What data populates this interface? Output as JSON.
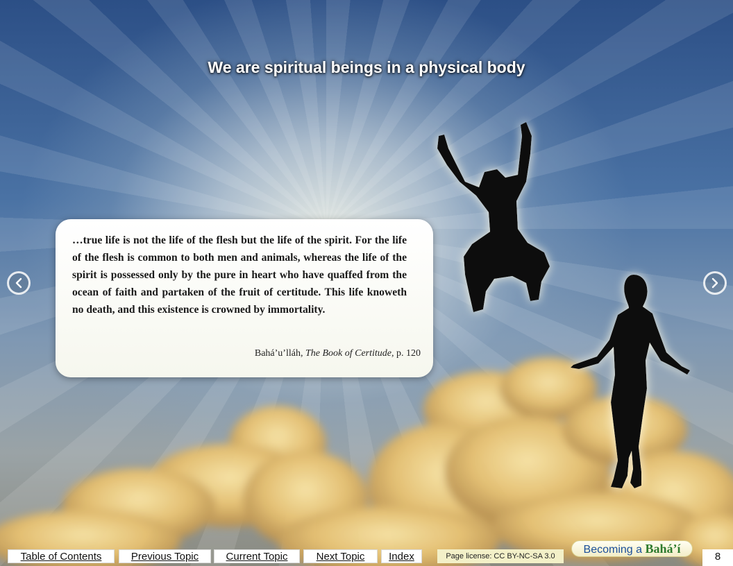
{
  "page": {
    "title": "We are spiritual beings in a physical body",
    "page_number": "8"
  },
  "quote": {
    "text": "…true life is not the life of the flesh but the life of the spirit. For the life of the flesh is common to both men and animals, whereas the life of the spirit is possessed only by the pure in heart who have quaffed from the ocean of faith and partaken of the fruit of certitude. This life knoweth no death, and this existence is crowned by immortality.",
    "author": "Bahá’u’lláh,",
    "book": "The Book of Certitude",
    "page_ref": ", p. 120"
  },
  "navigation": {
    "prev_icon": "chevron-left-icon",
    "next_icon": "chevron-right-icon"
  },
  "footer": {
    "links": [
      "Table of Contents",
      "Previous Topic",
      "Current Topic",
      "Next Topic",
      "Index"
    ],
    "license": "Page license: CC BY-NC-SA  3.0",
    "brand_prefix": "Becoming a",
    "brand_name": "Bahá’í"
  },
  "colors": {
    "sky_top": "#2c4f86",
    "cloud_gold": "#e8c272",
    "silhouette": "#0a0a0a",
    "brand_blue": "#1b4f9a",
    "brand_green": "#2d7a2d"
  }
}
